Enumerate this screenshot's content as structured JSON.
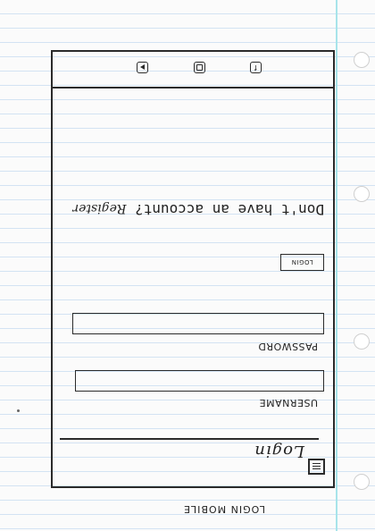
{
  "screen": {
    "caption": "LOGIN MOBILE"
  },
  "header": {
    "menu_icon": "hamburger-menu-icon",
    "title": "Login"
  },
  "form": {
    "username_label": "USERNAME",
    "username_value": "",
    "password_label": "PASSWORD",
    "password_value": "",
    "login_button": "LOGIN"
  },
  "register": {
    "prompt": "Don't have an account?",
    "link": "Register"
  },
  "footer": {
    "icons": [
      "facebook-icon",
      "instagram-icon",
      "play-icon"
    ],
    "facebook_glyph": "f"
  },
  "colors": {
    "ink": "#2b2b2b",
    "paper": "#fbfbfb",
    "ruled_line": "#d3e3f3",
    "margin_line": "#a7e4ea"
  }
}
